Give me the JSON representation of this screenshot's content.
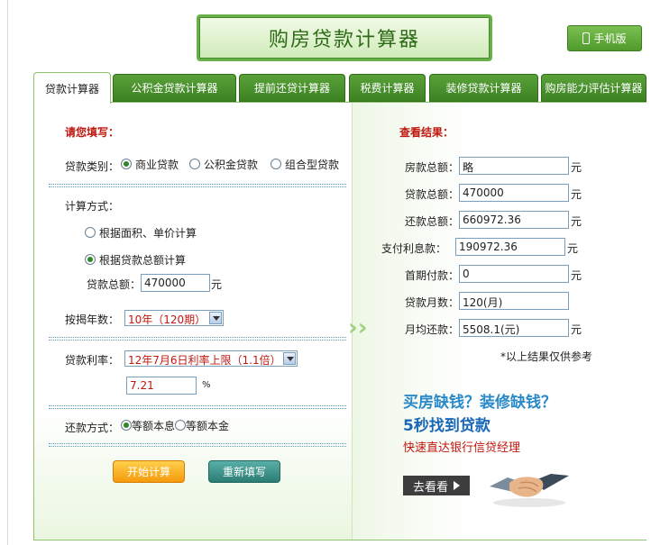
{
  "header": {
    "title": "购房贷款计算器",
    "mobile_label": "手机版"
  },
  "tabs": [
    {
      "label": "贷款计算器",
      "active": true
    },
    {
      "label": "公积金贷款计算器",
      "active": false
    },
    {
      "label": "提前还贷计算器",
      "active": false
    },
    {
      "label": "税费计算器",
      "active": false
    },
    {
      "label": "装修贷款计算器",
      "active": false
    },
    {
      "label": "购房能力评估计算器",
      "active": false
    }
  ],
  "form": {
    "heading": "请您填写：",
    "loan_type_label": "贷款类别：",
    "loan_type_options": [
      "商业贷款",
      "公积金贷款",
      "组合型贷款"
    ],
    "loan_type_selected": "商业贷款",
    "calc_method_label": "计算方式：",
    "calc_options": [
      "根据面积、单价计算",
      "根据贷款总额计算"
    ],
    "calc_selected": "根据贷款总额计算",
    "loan_total_label": "贷款总额：",
    "loan_total_value": "470000",
    "loan_total_unit": "元",
    "years_label": "按揭年数：",
    "years_value": "10年（120期）",
    "rate_label": "贷款利率：",
    "rate_value": "12年7月6日利率上限（1.1倍）",
    "rate_input": "7.21",
    "rate_unit": "%",
    "repay_label": "还款方式：",
    "repay_options": [
      "等额本息",
      "等额本金"
    ],
    "repay_selected": "等额本息",
    "start_button": "开始计算",
    "reset_button": "重新填写"
  },
  "results": {
    "heading": "查看结果：",
    "rows": [
      {
        "label": "房款总额：",
        "value": "略",
        "unit": "元"
      },
      {
        "label": "贷款总额：",
        "value": "470000",
        "unit": "元"
      },
      {
        "label": "还款总额：",
        "value": "660972.36",
        "unit": "元"
      },
      {
        "label": "支付利息款：",
        "value": "190972.36",
        "unit": "元"
      },
      {
        "label": "首期付款：",
        "value": "0",
        "unit": "元"
      },
      {
        "label": "贷款月数：",
        "value": "120(月)",
        "unit": ""
      },
      {
        "label": "月均还款：",
        "value": "5508.1(元)",
        "unit": "元"
      }
    ],
    "note": "*以上结果仅供参考"
  },
  "ad": {
    "line1": "买房缺钱？装修缺钱？",
    "line2": "5秒找到贷款",
    "line3": "快速直达银行信贷经理",
    "button": "去看看"
  },
  "colors": {
    "tab_green": "#3d8223",
    "heading_red": "#c0170f",
    "start_orange": "#f59a0c",
    "reset_teal": "#2b7c74"
  }
}
